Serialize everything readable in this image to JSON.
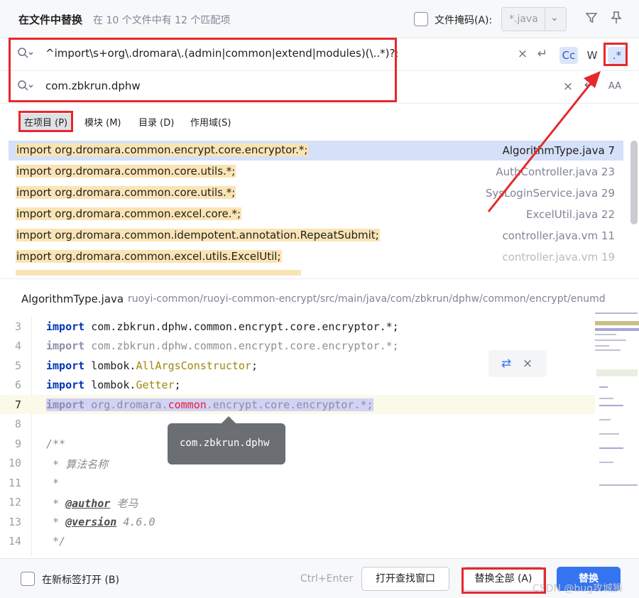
{
  "dialog": {
    "title": "在文件中替换",
    "match_info": "在 10 个文件中有 12 个匹配项",
    "file_mask_label": "文件掩码(A):",
    "file_mask_value": "*.java"
  },
  "search": {
    "query": "^import\\s+org\\.dromara\\.(admin|common|extend|modules)(\\..*)?;",
    "replace": "com.zbkrun.dphw",
    "options": {
      "case": "Cc",
      "words": "W",
      "regex": ".*"
    },
    "regex_enabled": true
  },
  "scopes": [
    {
      "label": "在项目 (P)",
      "active": true
    },
    {
      "label": "模块 (M)",
      "active": false
    },
    {
      "label": "目录 (D)",
      "active": false
    },
    {
      "label": "作用域(S)",
      "active": false
    }
  ],
  "results": [
    {
      "code": "import org.dromara.common.encrypt.core.encryptor.*;",
      "file": "AlgorithmType.java 7",
      "selected": true
    },
    {
      "code": "import org.dromara.common.core.utils.*;",
      "file": "AuthController.java 23",
      "selected": false
    },
    {
      "code": "import org.dromara.common.core.utils.*;",
      "file": "SysLoginService.java 29",
      "selected": false
    },
    {
      "code": "import org.dromara.common.excel.core.*;",
      "file": "ExcelUtil.java 22",
      "selected": false
    },
    {
      "code": "import org.dromara.common.idempotent.annotation.RepeatSubmit;",
      "file": "controller.java.vm 11",
      "selected": false
    },
    {
      "code": "import org.dromara.common.excel.utils.ExcelUtil;",
      "file": "controller.java.vm 19",
      "selected": false
    }
  ],
  "preview": {
    "file": "AlgorithmType.java",
    "path": "ruoyi-common/ruoyi-common-encrypt/src/main/java/com/zbkrun/dphw/common/encrypt/enumd",
    "tooltip": "com.zbkrun.dphw",
    "lines": [
      {
        "num": "3",
        "kw": "import",
        "rest": " com.zbkrun.dphw.common.encrypt.core.encryptor.*;"
      },
      {
        "num": "4",
        "kw": "import",
        "rest": " com.zbkrun.dphw.common.encrypt.core.encryptor.*;"
      },
      {
        "num": "5",
        "kw": "import",
        "rest_a": " lombok.",
        "rest_b": "AllArgsConstructor",
        "rest_c": ";"
      },
      {
        "num": "6",
        "kw": "import",
        "rest_a": " lombok.",
        "rest_b": "Getter",
        "rest_c": ";"
      },
      {
        "num": "7",
        "kw": "import",
        "rest_a": " org.dromara.",
        "rest_b": "common",
        "rest_c": ".encrypt.core.encryptor.*;"
      },
      {
        "num": "8"
      },
      {
        "num": "9",
        "text": "/**"
      },
      {
        "num": "10",
        "text": " * 算法名称"
      },
      {
        "num": "11",
        "text": " *"
      },
      {
        "num": "12",
        "pre": " * ",
        "tag": "@author",
        "post": " 老马"
      },
      {
        "num": "13",
        "pre": " * ",
        "tag": "@version",
        "post": " 4.6.0"
      },
      {
        "num": "14",
        "text": " */"
      }
    ]
  },
  "footer": {
    "new_tab_label": "在新标签打开 (B)",
    "shortcut_hint": "Ctrl+Enter",
    "open_find_window": "打开查找窗口",
    "replace_all": "替换全部 (A)",
    "replace": "替换",
    "watermark": "CSDN @bug攻城狮"
  },
  "colors": {
    "accent": "#3574f0",
    "annotation_red": "#e6282d",
    "match_highlight": "#fbe4b4"
  }
}
